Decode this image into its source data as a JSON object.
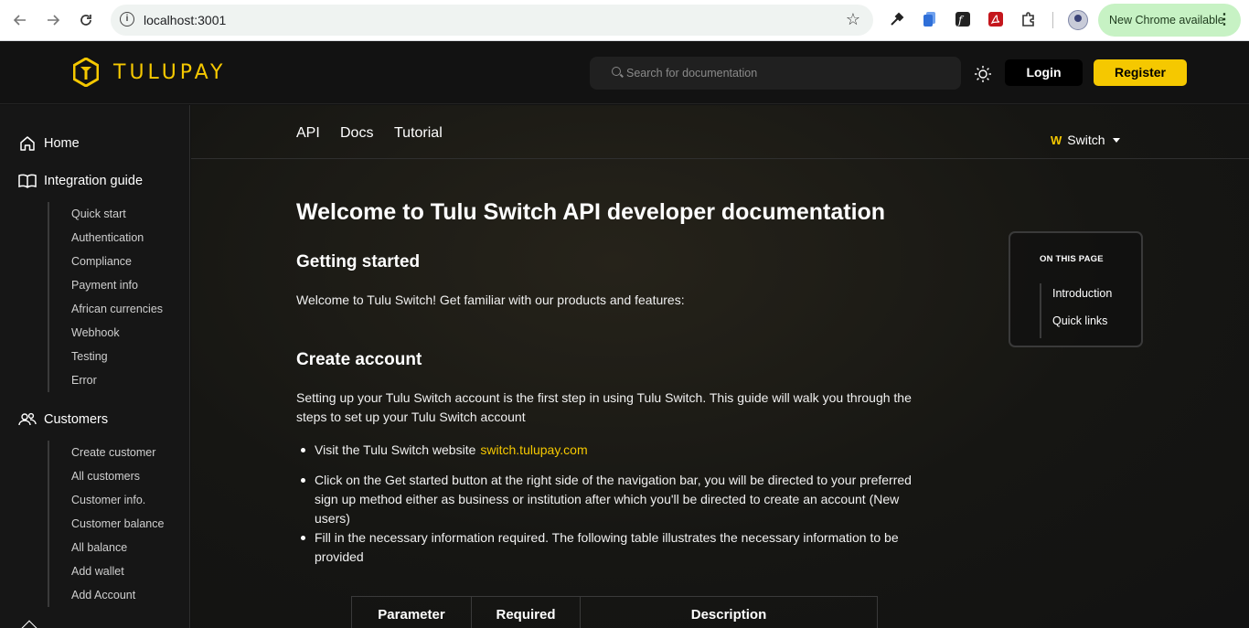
{
  "browser": {
    "url": "localhost:3001",
    "update_label": "New Chrome available"
  },
  "header": {
    "brand": "TULUPAY",
    "search_placeholder": "Search for documentation",
    "login": "Login",
    "register": "Register"
  },
  "sidebar": {
    "home": "Home",
    "integration": {
      "label": "Integration guide",
      "items": [
        "Quick start",
        "Authentication",
        "Compliance",
        "Payment info",
        "African currencies",
        "Webhook",
        "Testing",
        "Error"
      ]
    },
    "customers": {
      "label": "Customers",
      "items": [
        "Create customer",
        "All customers",
        "Customer info.",
        "Customer balance",
        "All balance",
        "Add wallet",
        "Add Account"
      ]
    }
  },
  "tabs": [
    "API",
    "Docs",
    "Tutorial"
  ],
  "product_switch": "Switch",
  "article": {
    "title": "Welcome to Tulu Switch API developer documentation",
    "getting_started": "Getting started",
    "intro": "Welcome to Tulu Switch! Get familiar with our products and features:",
    "create_account": "Create account",
    "setup": "Setting up your Tulu Switch account is the first step in using Tulu Switch. This guide will walk you through the steps to set up your Tulu Switch account",
    "bullet1_text": "Visit the Tulu Switch website",
    "bullet1_link": "switch.tulupay.com",
    "bullet2": "Click on the Get started button at the right side of the navigation bar, you will be directed to your preferred sign up method either as business or institution after which you'll be directed to create an account (New users)",
    "bullet3": "Fill in the necessary information required. The following table illustrates the necessary information to be provided",
    "table_headers": [
      "Parameter",
      "Required",
      "Description"
    ]
  },
  "toc": {
    "title": "ON THIS PAGE",
    "items": [
      "Introduction",
      "Quick links"
    ]
  },
  "colors": {
    "brand": "#f5c800",
    "background": "#121212"
  }
}
